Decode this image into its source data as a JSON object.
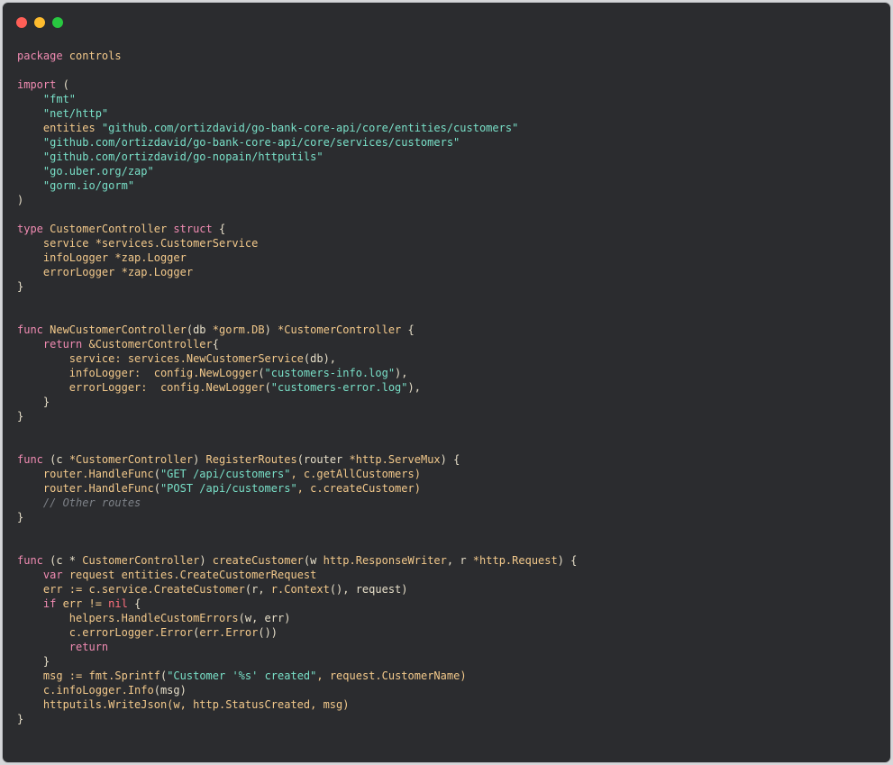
{
  "window": {
    "controls": [
      "close",
      "minimize",
      "zoom"
    ]
  },
  "code": {
    "lines": [
      [
        {
          "t": "package",
          "c": "kw"
        },
        {
          "t": " controls",
          "c": "ty"
        }
      ],
      [],
      [
        {
          "t": "import",
          "c": "kw"
        },
        {
          "t": " (",
          "c": "id"
        }
      ],
      [
        {
          "t": "    ",
          "c": "id"
        },
        {
          "t": "\"fmt\"",
          "c": "str"
        }
      ],
      [
        {
          "t": "    ",
          "c": "id"
        },
        {
          "t": "\"net/http\"",
          "c": "str"
        }
      ],
      [
        {
          "t": "    entities ",
          "c": "ty"
        },
        {
          "t": "\"github.com/ortizdavid/go-bank-core-api/core/entities/customers\"",
          "c": "str"
        }
      ],
      [
        {
          "t": "    ",
          "c": "id"
        },
        {
          "t": "\"github.com/ortizdavid/go-bank-core-api/core/services/customers\"",
          "c": "str"
        }
      ],
      [
        {
          "t": "    ",
          "c": "id"
        },
        {
          "t": "\"github.com/ortizdavid/go-nopain/httputils\"",
          "c": "str"
        }
      ],
      [
        {
          "t": "    ",
          "c": "id"
        },
        {
          "t": "\"go.uber.org/zap\"",
          "c": "str"
        }
      ],
      [
        {
          "t": "    ",
          "c": "id"
        },
        {
          "t": "\"gorm.io/gorm\"",
          "c": "str"
        }
      ],
      [
        {
          "t": ")",
          "c": "id"
        }
      ],
      [],
      [
        {
          "t": "type",
          "c": "kw"
        },
        {
          "t": " CustomerController ",
          "c": "ty"
        },
        {
          "t": "struct",
          "c": "kw"
        },
        {
          "t": " {",
          "c": "id"
        }
      ],
      [
        {
          "t": "    service ",
          "c": "ty"
        },
        {
          "t": "*services.CustomerService",
          "c": "ty"
        }
      ],
      [
        {
          "t": "    infoLogger ",
          "c": "ty"
        },
        {
          "t": "*zap.Logger",
          "c": "ty"
        }
      ],
      [
        {
          "t": "    errorLogger ",
          "c": "ty"
        },
        {
          "t": "*zap.Logger",
          "c": "ty"
        }
      ],
      [
        {
          "t": "}",
          "c": "id"
        }
      ],
      [],
      [],
      [
        {
          "t": "func",
          "c": "kw"
        },
        {
          "t": " NewCustomerController",
          "c": "fn"
        },
        {
          "t": "(db ",
          "c": "id"
        },
        {
          "t": "*gorm.DB",
          "c": "ty"
        },
        {
          "t": ") ",
          "c": "id"
        },
        {
          "t": "*CustomerController",
          "c": "ty"
        },
        {
          "t": " {",
          "c": "id"
        }
      ],
      [
        {
          "t": "    ",
          "c": "id"
        },
        {
          "t": "return",
          "c": "kw"
        },
        {
          "t": " &CustomerController",
          "c": "ty"
        },
        {
          "t": "{",
          "c": "id"
        }
      ],
      [
        {
          "t": "        service: ",
          "c": "ty"
        },
        {
          "t": "services.NewCustomerService",
          "c": "fn"
        },
        {
          "t": "(db),",
          "c": "id"
        }
      ],
      [
        {
          "t": "        infoLogger:  ",
          "c": "ty"
        },
        {
          "t": "config.NewLogger",
          "c": "fn"
        },
        {
          "t": "(",
          "c": "id"
        },
        {
          "t": "\"customers-info.log\"",
          "c": "str"
        },
        {
          "t": "),",
          "c": "id"
        }
      ],
      [
        {
          "t": "        errorLogger:  ",
          "c": "ty"
        },
        {
          "t": "config.NewLogger",
          "c": "fn"
        },
        {
          "t": "(",
          "c": "id"
        },
        {
          "t": "\"customers-error.log\"",
          "c": "str"
        },
        {
          "t": "),",
          "c": "id"
        }
      ],
      [
        {
          "t": "    }",
          "c": "id"
        }
      ],
      [
        {
          "t": "}",
          "c": "id"
        }
      ],
      [],
      [],
      [
        {
          "t": "func",
          "c": "kw"
        },
        {
          "t": " (c ",
          "c": "id"
        },
        {
          "t": "*CustomerController",
          "c": "ty"
        },
        {
          "t": ") ",
          "c": "id"
        },
        {
          "t": "RegisterRoutes",
          "c": "fn"
        },
        {
          "t": "(router ",
          "c": "id"
        },
        {
          "t": "*http.ServeMux",
          "c": "ty"
        },
        {
          "t": ") {",
          "c": "id"
        }
      ],
      [
        {
          "t": "    router.HandleFunc",
          "c": "fn"
        },
        {
          "t": "(",
          "c": "id"
        },
        {
          "t": "\"GET /api/customers\"",
          "c": "str"
        },
        {
          "t": ", c.getAllCustomers)",
          "c": "fn"
        }
      ],
      [
        {
          "t": "    router.HandleFunc",
          "c": "fn"
        },
        {
          "t": "(",
          "c": "id"
        },
        {
          "t": "\"POST /api/customers\"",
          "c": "str"
        },
        {
          "t": ", c.createCustomer)",
          "c": "fn"
        }
      ],
      [
        {
          "t": "    // Other routes",
          "c": "cm"
        }
      ],
      [
        {
          "t": "}",
          "c": "id"
        }
      ],
      [],
      [],
      [
        {
          "t": "func",
          "c": "kw"
        },
        {
          "t": " (c * ",
          "c": "id"
        },
        {
          "t": "CustomerController",
          "c": "ty"
        },
        {
          "t": ") ",
          "c": "id"
        },
        {
          "t": "createCustomer",
          "c": "fn"
        },
        {
          "t": "(w ",
          "c": "id"
        },
        {
          "t": "http.ResponseWriter",
          "c": "ty"
        },
        {
          "t": ", r ",
          "c": "id"
        },
        {
          "t": "*http.Request",
          "c": "ty"
        },
        {
          "t": ") {",
          "c": "id"
        }
      ],
      [
        {
          "t": "    ",
          "c": "id"
        },
        {
          "t": "var",
          "c": "kw"
        },
        {
          "t": " request ",
          "c": "ty"
        },
        {
          "t": "entities.CreateCustomerRequest",
          "c": "ty"
        }
      ],
      [
        {
          "t": "    err := ",
          "c": "ty"
        },
        {
          "t": "c.service.CreateCustomer",
          "c": "fn"
        },
        {
          "t": "(r, ",
          "c": "id"
        },
        {
          "t": "r.Context",
          "c": "fn"
        },
        {
          "t": "(), request)",
          "c": "id"
        }
      ],
      [
        {
          "t": "    ",
          "c": "id"
        },
        {
          "t": "if",
          "c": "kw"
        },
        {
          "t": " err != ",
          "c": "ty"
        },
        {
          "t": "nil",
          "c": "nil"
        },
        {
          "t": " {",
          "c": "id"
        }
      ],
      [
        {
          "t": "        helpers.HandleCustomErrors",
          "c": "fn"
        },
        {
          "t": "(w, err)",
          "c": "id"
        }
      ],
      [
        {
          "t": "        c.errorLogger.Error",
          "c": "fn"
        },
        {
          "t": "(",
          "c": "id"
        },
        {
          "t": "err.Error",
          "c": "fn"
        },
        {
          "t": "())",
          "c": "id"
        }
      ],
      [
        {
          "t": "        ",
          "c": "id"
        },
        {
          "t": "return",
          "c": "kw"
        }
      ],
      [
        {
          "t": "    }",
          "c": "id"
        }
      ],
      [
        {
          "t": "    msg := ",
          "c": "ty"
        },
        {
          "t": "fmt.Sprintf",
          "c": "fn"
        },
        {
          "t": "(",
          "c": "id"
        },
        {
          "t": "\"Customer '%s' created\"",
          "c": "str"
        },
        {
          "t": ", request.CustomerName)",
          "c": "ty"
        }
      ],
      [
        {
          "t": "    c.infoLogger.Info",
          "c": "fn"
        },
        {
          "t": "(msg)",
          "c": "id"
        }
      ],
      [
        {
          "t": "    httputils.WriteJson",
          "c": "fn"
        },
        {
          "t": "(w, http.StatusCreated, msg)",
          "c": "ty"
        }
      ],
      [
        {
          "t": "}",
          "c": "id"
        }
      ]
    ]
  }
}
